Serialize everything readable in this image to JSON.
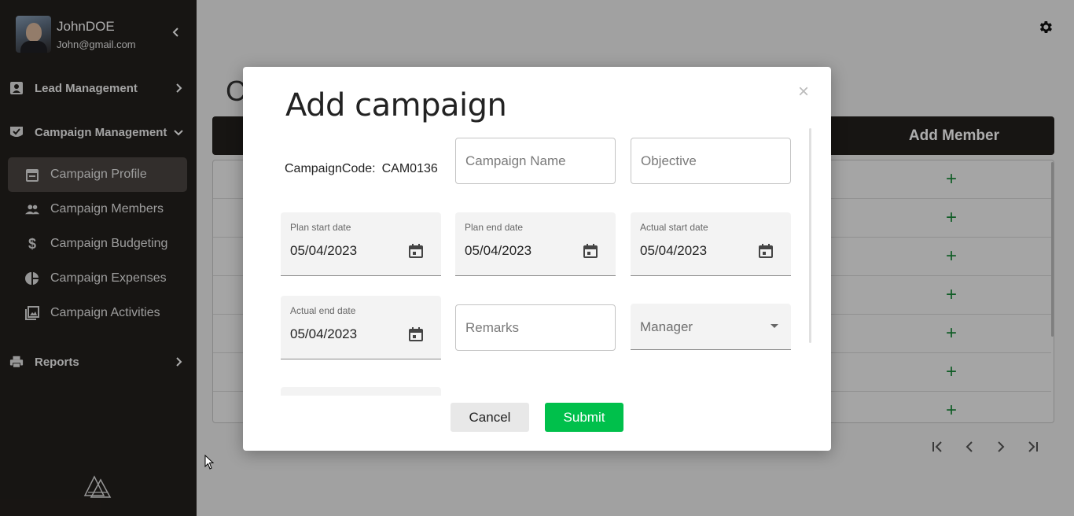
{
  "sidebar": {
    "user_name": "JohnDOE",
    "user_email": "John@gmail.com",
    "sections": {
      "lead": "Lead Management",
      "campaign": "Campaign Management",
      "reports": "Reports"
    },
    "items": [
      {
        "label": "Campaign Profile",
        "icon": "calendar-icon"
      },
      {
        "label": "Campaign Members",
        "icon": "people-icon"
      },
      {
        "label": "Campaign Budgeting",
        "icon": "dollar-icon"
      },
      {
        "label": "Campaign Expenses",
        "icon": "pie-icon"
      },
      {
        "label": "Campaign Activities",
        "icon": "photos-icon"
      }
    ]
  },
  "background": {
    "title": "C",
    "header_label": "Add Member",
    "row_action": "+"
  },
  "modal": {
    "title": "Add campaign",
    "close": "×",
    "code_label": "CampaignCode:",
    "code_value": "CAM0136",
    "campaign_name_placeholder": "Campaign Name",
    "objective_placeholder": "Objective",
    "plan_start_label": "Plan start date",
    "plan_start_value": "05/04/2023",
    "plan_end_label": "Plan end date",
    "plan_end_value": "05/04/2023",
    "actual_start_label": "Actual start date",
    "actual_start_value": "05/04/2023",
    "actual_end_label": "Actual end date",
    "actual_end_value": "05/04/2023",
    "remarks_placeholder": "Remarks",
    "manager_label": "Manager",
    "cancel": "Cancel",
    "submit": "Submit"
  },
  "colors": {
    "sidebar_bg": "#231f1c",
    "active_item_bg": "#4a4541",
    "submit_green": "#00c04b",
    "plus_green": "#1a8a3a"
  }
}
